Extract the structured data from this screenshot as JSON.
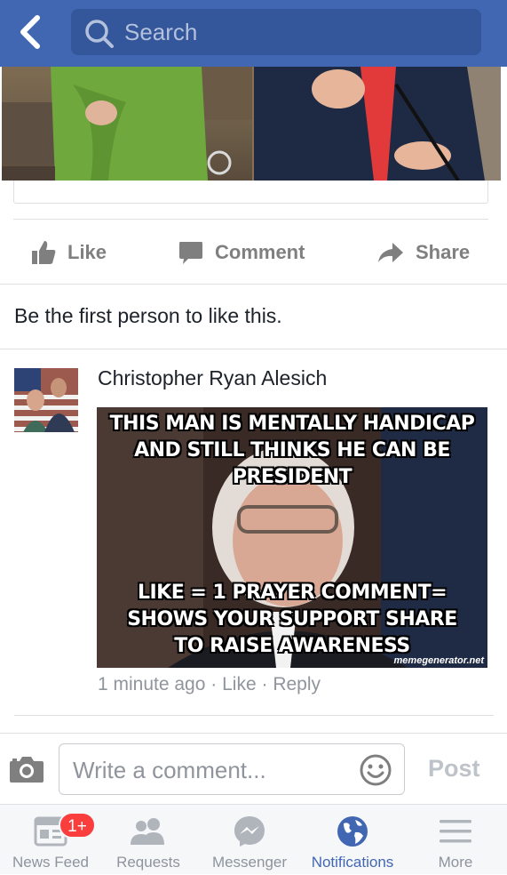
{
  "header": {
    "back_icon": "back-chevron-icon",
    "search_placeholder": "Search",
    "colors": {
      "bar": "#4267b2",
      "search_bg": "#34569a"
    }
  },
  "post": {
    "actions": [
      {
        "label": "Like",
        "icon": "thumbs-up-icon"
      },
      {
        "label": "Comment",
        "icon": "speech-bubble-icon"
      },
      {
        "label": "Share",
        "icon": "share-arrow-icon"
      }
    ],
    "likes_text": "Be the first person to like this."
  },
  "comment": {
    "author": "Christopher Ryan Alesich",
    "meme_top": "THIS MAN IS MENTALLY HANDICAP AND STILL THINKS HE CAN BE PRESIDENT",
    "meme_bottom": "LIKE = 1 PRAYER  COMMENT= SHOWS YOUR SUPPORT   SHARE TO RAISE AWARENESS",
    "meme_watermark": "memegenerator.net",
    "time": "1 minute ago",
    "like_link": "Like",
    "reply_link": "Reply",
    "separator": "·"
  },
  "composer": {
    "placeholder": "Write a comment...",
    "post_label": "Post"
  },
  "tabs": [
    {
      "label": "News Feed",
      "icon": "news-feed-icon",
      "badge": "1+"
    },
    {
      "label": "Requests",
      "icon": "friends-icon"
    },
    {
      "label": "Messenger",
      "icon": "messenger-icon"
    },
    {
      "label": "Notifications",
      "icon": "globe-icon",
      "active": true
    },
    {
      "label": "More",
      "icon": "hamburger-icon"
    }
  ]
}
